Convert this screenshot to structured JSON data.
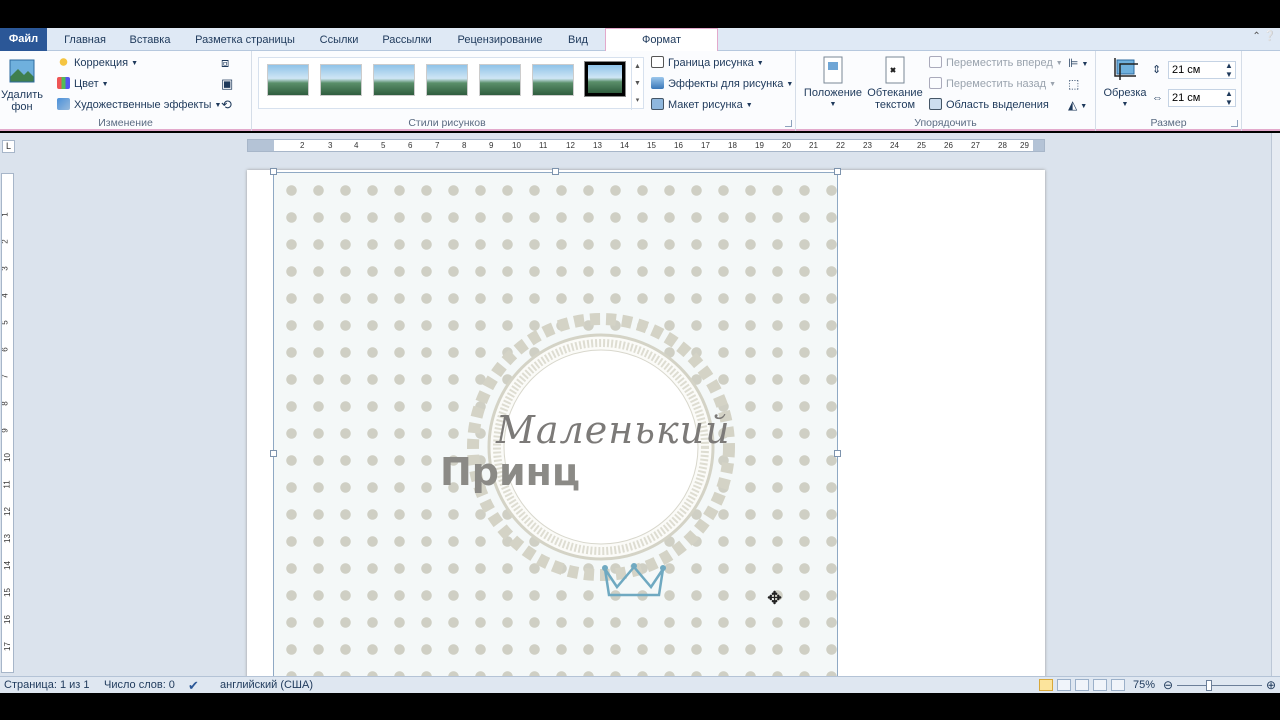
{
  "tabs": {
    "file": "Файл",
    "items": [
      "Главная",
      "Вставка",
      "Разметка страницы",
      "Ссылки",
      "Рассылки",
      "Рецензирование",
      "Вид"
    ],
    "active": "Формат"
  },
  "ribbon": {
    "adjust": {
      "remove_bg_line1": "Удалить",
      "remove_bg_line2": "фон",
      "correction": "Коррекция",
      "color": "Цвет",
      "artistic": "Художественные эффекты",
      "label": "Изменение"
    },
    "styles": {
      "border": "Граница рисунка",
      "effects": "Эффекты для рисунка",
      "layout": "Макет рисунка",
      "label": "Стили рисунков"
    },
    "arrange": {
      "position": "Положение",
      "wrap_line1": "Обтекание",
      "wrap_line2": "текстом",
      "bring_forward": "Переместить вперед",
      "send_backward": "Переместить назад",
      "selection_pane": "Область выделения",
      "label": "Упорядочить"
    },
    "size": {
      "crop": "Обрезка",
      "height": "21 см",
      "width": "21 см",
      "label": "Размер"
    }
  },
  "document": {
    "image_title": "Маленький",
    "image_subtitle": "Принц"
  },
  "statusbar": {
    "page": "Страница: 1 из 1",
    "words": "Число слов: 0",
    "language": "английский (США)",
    "zoom": "75%"
  },
  "zoom_level": 0.75,
  "colors": {
    "file_tab": "#2b5797",
    "context_accent": "#e3a9cc",
    "ribbon_bg": "#fbfcfe",
    "workspace": "#dbe3ed"
  }
}
